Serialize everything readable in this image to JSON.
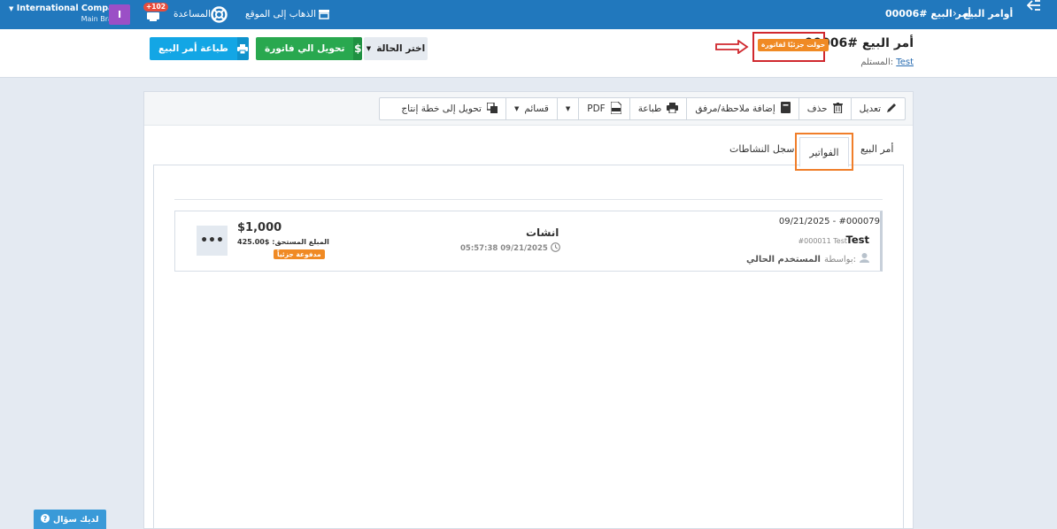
{
  "topbar": {
    "breadcrumb_root": "أوامر البيع",
    "breadcrumb_current": "أمر البيع #00006",
    "company_name": "International Company",
    "company_branch": "Main Branch",
    "avatar_initial": "I",
    "notification_count": "+102",
    "help_label": "المساعدة",
    "site_label": "الذهاب إلى الموقع"
  },
  "header": {
    "title": "أمر البيع #00006",
    "status_badge": "حولت جزئيًا لفاتورة",
    "receiver_label": "المستلم:",
    "receiver_value": "Test",
    "status_select_label": "اختر الحالة",
    "convert_button": "تحويل الي فاتورة",
    "print_button": "طباعة أمر البيع"
  },
  "toolbar": {
    "edit": "تعديل",
    "delete": "حذف",
    "add_note": "إضافة ملاحظة/مرفق",
    "print": "طباعة",
    "pdf": "PDF",
    "vouchers": "قسائم",
    "convert_production": "تحويل إلى خطة إنتاج"
  },
  "tabs": {
    "sales_order": "أمر البيع",
    "invoices": "الفواتير",
    "activity_log": "سجل النشاطات"
  },
  "invoice": {
    "number_date": "09/21/2025 - #000079",
    "client": "Test",
    "client_ref": "#000011 Test",
    "by_label": "بواسطة:",
    "by_name": "المستخدم الحالي",
    "title": "انشات",
    "datetime": "05:57:38 09/21/2025",
    "amount": "$1,000",
    "due_label": "المبلغ المستحق:",
    "due_value": "$425.00",
    "paid_status": "مدفوعة جزئياً",
    "more": "•••"
  },
  "footer": {
    "help_question": "لديك سؤال"
  },
  "colors": {
    "topbar": "#2178bd",
    "print_button": "#13a6e5",
    "convert_button": "#29a84f",
    "status_orange": "#f08a24",
    "highlight_red": "#d0282e",
    "highlight_orange": "#f07e2a"
  }
}
